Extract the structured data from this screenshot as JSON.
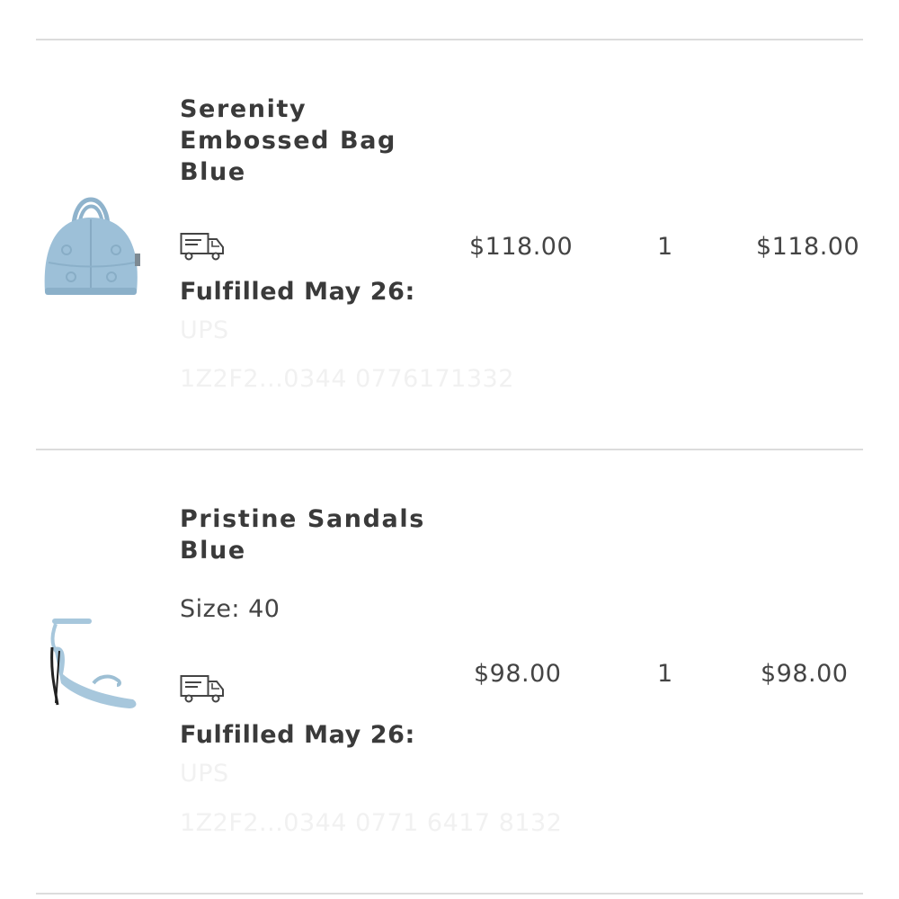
{
  "items": [
    {
      "title_lines": [
        "Serenity",
        "Embossed Bag",
        "Blue"
      ],
      "size_text": "",
      "image": "blue-handbag",
      "fulfilled_label": "Fulfilled May 26:",
      "faded_carrier": "UPS",
      "faded_tracking": "1Z2F2...0344 0776171332",
      "price": "$118.00",
      "quantity": "1",
      "total": "$118.00"
    },
    {
      "title_lines": [
        "Pristine Sandals",
        "Blue"
      ],
      "size_text": "Size: 40",
      "image": "blue-sandal",
      "fulfilled_label": "Fulfilled May 26:",
      "faded_carrier": "UPS",
      "faded_tracking": "1Z2F2...0344 0771 6417 8132",
      "price": "$98.00",
      "quantity": "1",
      "total": "$98.00"
    }
  ],
  "icons": {
    "shipping": "delivery-truck-icon"
  },
  "colors": {
    "text": "#3a3a3a",
    "divider": "#dcdcdc",
    "product_blue": "#9dc0d8"
  }
}
